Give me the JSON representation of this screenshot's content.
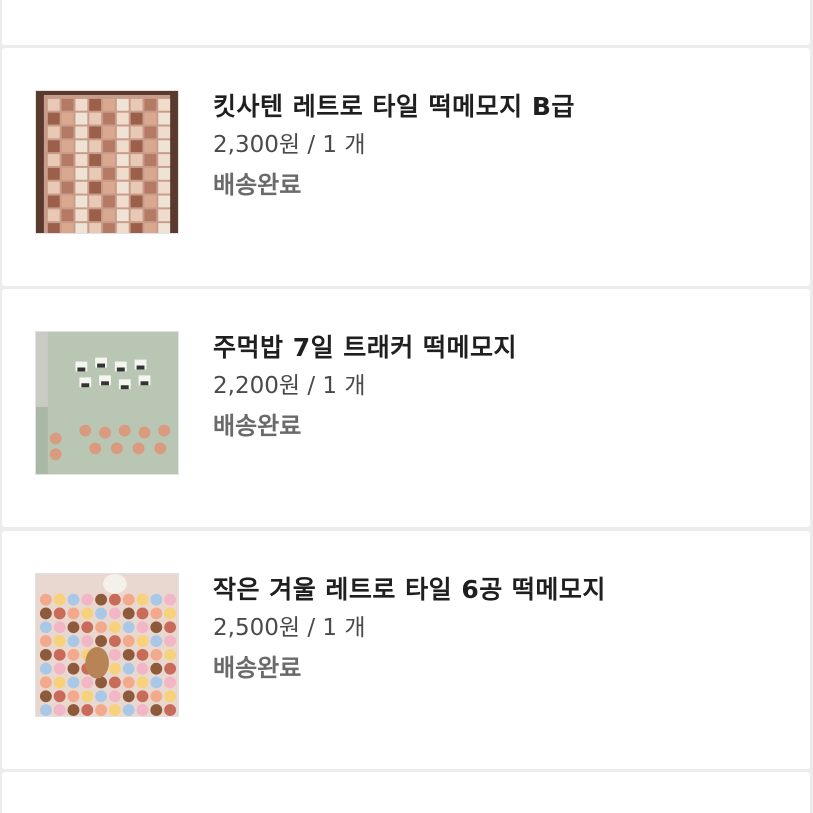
{
  "orders": [
    {
      "title": "킷사텐 레트로 타일 떡메모지 B급",
      "price_qty": "2,300원 / 1 개",
      "status": "배송완료",
      "thumbnail": "retro-tile-memo-thumbnail"
    },
    {
      "title": "주먹밥 7일 트래커 떡메모지",
      "price_qty": "2,200원 / 1 개",
      "status": "배송완료",
      "thumbnail": "rice-ball-tracker-memo-thumbnail"
    },
    {
      "title": "작은 겨울 레트로 타일 6공 떡메모지",
      "price_qty": "2,500원 / 1 개",
      "status": "배송완료",
      "thumbnail": "winter-retro-tile-memo-thumbnail"
    }
  ],
  "colors": {
    "background": "#ececec",
    "card": "#ffffff",
    "title_text": "#1f1f1f",
    "status_text": "#6a6a6a"
  }
}
